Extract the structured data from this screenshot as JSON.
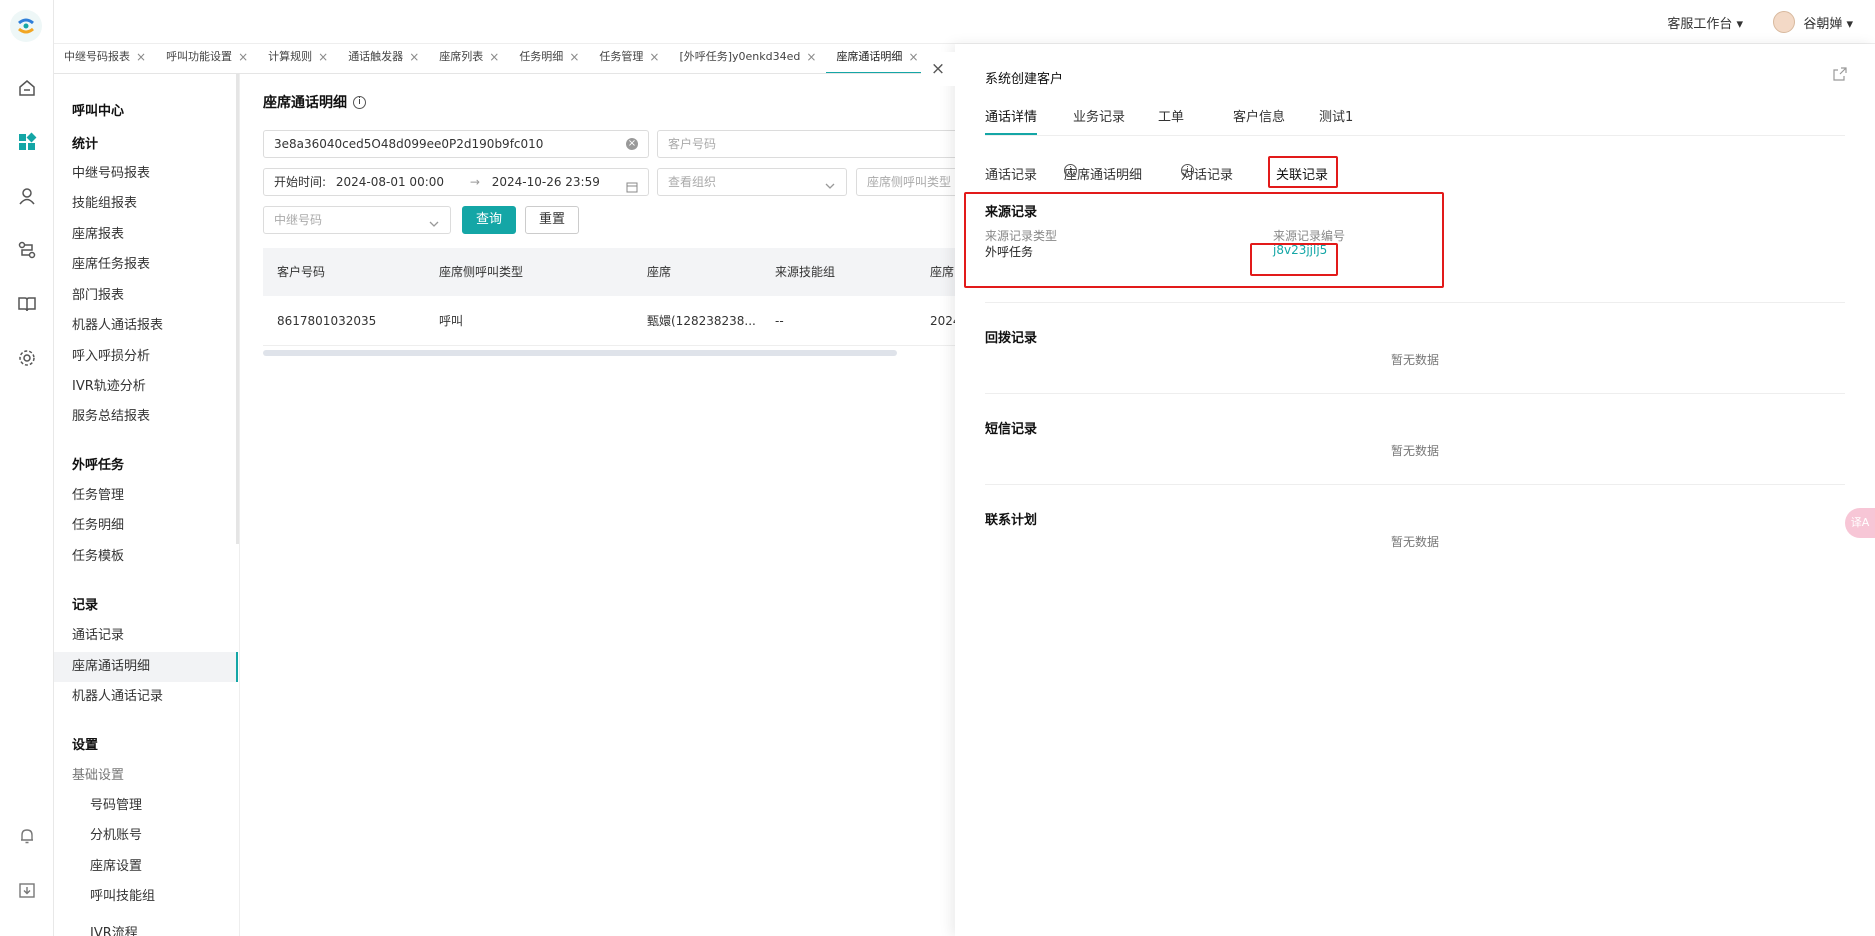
{
  "header": {
    "workspace_label": "客服工作台 ▾",
    "user_name": "谷朝婵 ▾"
  },
  "tabs": [
    {
      "label": "中继号码报表"
    },
    {
      "label": "呼叫功能设置"
    },
    {
      "label": "计算规则"
    },
    {
      "label": "通话触发器"
    },
    {
      "label": "座席列表"
    },
    {
      "label": "任务明细"
    },
    {
      "label": "任务管理"
    },
    {
      "label": "[外呼任务]y0enkd34ed"
    },
    {
      "label": "座席通话明细"
    },
    {
      "label": "["
    }
  ],
  "tab_close_glyph": "×",
  "sidebar": {
    "title": "呼叫中心",
    "sections": [
      {
        "heading": "统计",
        "items": [
          "中继号码报表",
          "技能组报表",
          "座席报表",
          "座席任务报表",
          "部门报表",
          "机器人通话报表",
          "呼入呼损分析",
          "IVR轨迹分析",
          "服务总结报表"
        ]
      },
      {
        "heading": "外呼任务",
        "items": [
          "任务管理",
          "任务明细",
          "任务模板"
        ]
      },
      {
        "heading": "记录",
        "items": [
          "通话记录",
          "座席通话明细",
          "机器人通话记录"
        ]
      },
      {
        "heading": "设置",
        "items": [
          "基础设置",
          "号码管理",
          "分机账号",
          "座席设置",
          "呼叫技能组",
          "IVR流程"
        ]
      }
    ]
  },
  "page": {
    "title": "座席通话明细",
    "filters": {
      "call_id": "3e8a36040ced5O48d099ee0P2d190b9fc010",
      "customer_placeholder": "客户号码",
      "start_label": "开始时间:",
      "start": "2024-08-01 00:00",
      "arrow": "→",
      "end": "2024-10-26 23:59",
      "org_placeholder": "查看组织",
      "call_type_placeholder": "座席侧呼叫类型",
      "trunk_placeholder": "中继号码",
      "query": "查询",
      "reset": "重置"
    },
    "table": {
      "columns": [
        "客户号码",
        "座席侧呼叫类型",
        "座席",
        "来源技能组",
        "座席"
      ],
      "rows": [
        [
          "8617801032035",
          "呼叫",
          "甄嬛(128238238...",
          "--",
          "2024"
        ]
      ]
    }
  },
  "drawer": {
    "close": "×",
    "title": "系统创建客户",
    "tabs": [
      "通话详情",
      "业务记录",
      "工单",
      "客户信息",
      "测试1"
    ],
    "subtabs": [
      "通话记录",
      "座席通话明细",
      "对话记录",
      "关联记录"
    ],
    "info_glyph": "i",
    "source": {
      "heading": "来源记录",
      "type_label": "来源记录类型",
      "type_value": "外呼任务",
      "id_label": "来源记录编号",
      "id_value": "j8v23jjlj5"
    },
    "sections": [
      {
        "heading": "回拨记录",
        "empty": "暂无数据"
      },
      {
        "heading": "短信记录",
        "empty": "暂无数据"
      },
      {
        "heading": "联系计划",
        "empty": "暂无数据"
      }
    ]
  },
  "float_widget": "译A"
}
